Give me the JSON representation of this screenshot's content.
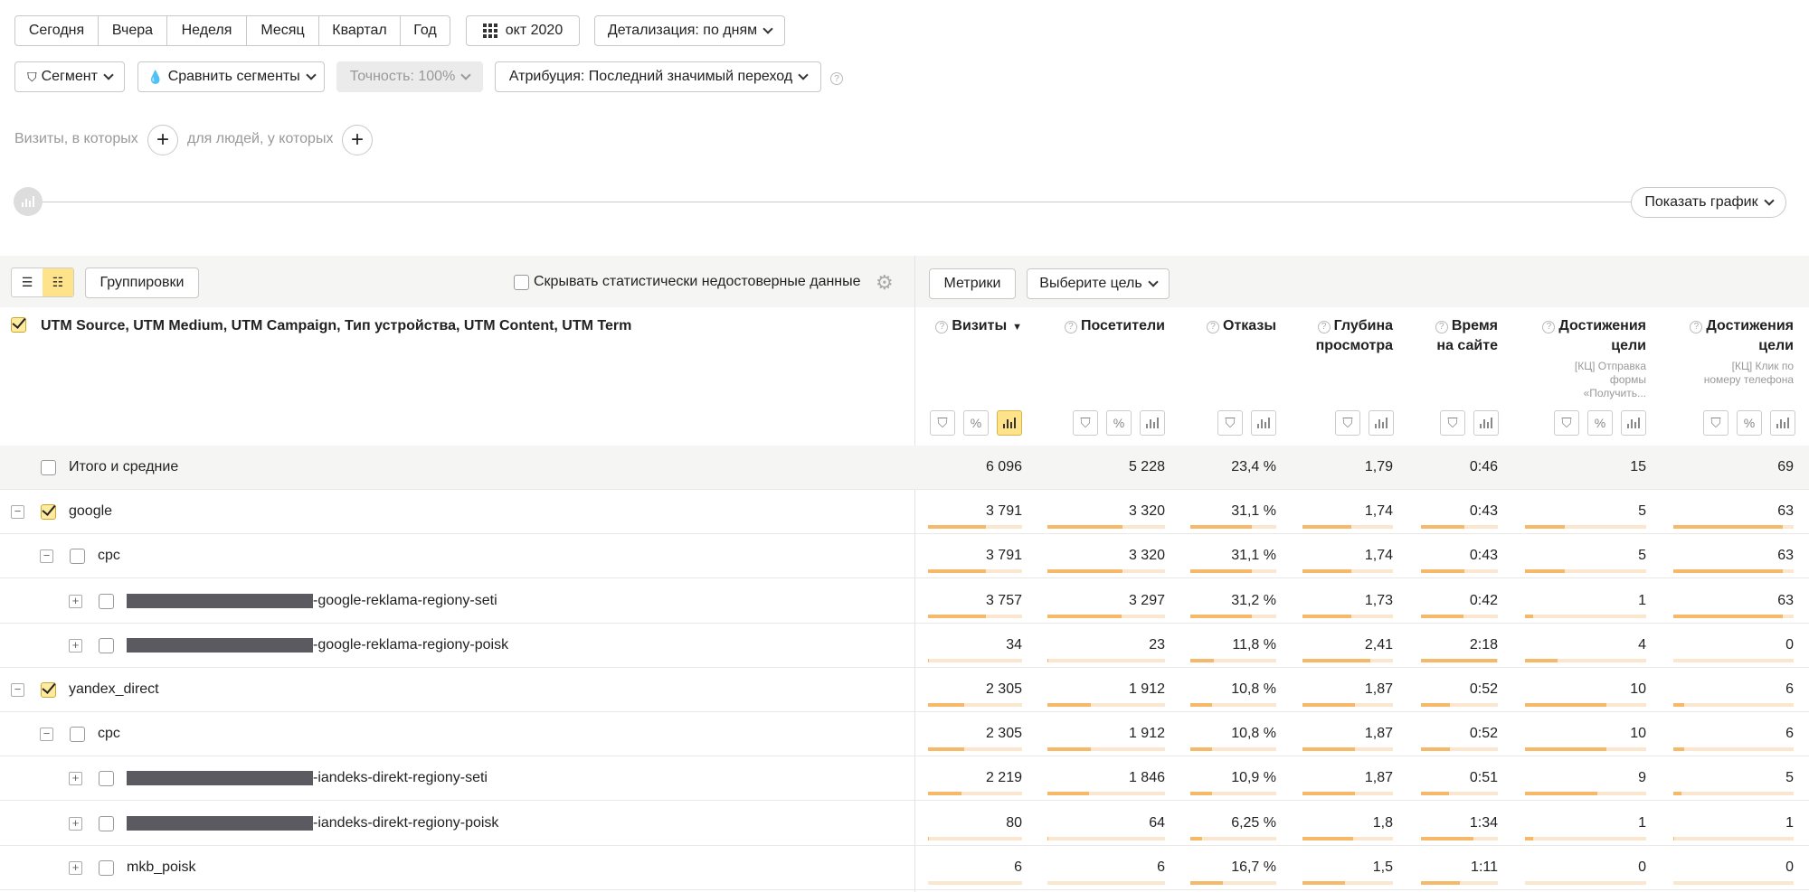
{
  "periods": [
    "Сегодня",
    "Вчера",
    "Неделя",
    "Месяц",
    "Квартал",
    "Год"
  ],
  "date_label": "окт 2020",
  "detail_label": "Детализация: по дням",
  "segment_label": "Сегмент",
  "compare_label": "Сравнить сегменты",
  "accuracy_label": "Точность: 100%",
  "attribution_label": "Атрибуция: Последний значимый переход",
  "visits_where": "Визиты, в которых",
  "people_where": "для людей, у которых",
  "show_chart": "Показать график",
  "groupings_label": "Группировки",
  "hide_unreliable": "Скрывать статистически недостоверные данные",
  "metrics_label": "Метрики",
  "choose_goal": "Выберите цель",
  "dimension_header": "UTM Source, UTM Medium, UTM Campaign, Тип устройства, UTM Content, UTM Term",
  "columns": [
    {
      "line1": "Визиты",
      "line2": "",
      "sub": "",
      "sort": "▼"
    },
    {
      "line1": "Посетители",
      "line2": "",
      "sub": "",
      "sort": ""
    },
    {
      "line1": "Отказы",
      "line2": "",
      "sub": "",
      "sort": ""
    },
    {
      "line1": "Глубина",
      "line2": "просмотра",
      "sub": "",
      "sort": ""
    },
    {
      "line1": "Время",
      "line2": "на сайте",
      "sub": "",
      "sort": ""
    },
    {
      "line1": "Достижения",
      "line2": "цели",
      "sub": "[КЦ] Отправка формы «Получить...",
      "sort": ""
    },
    {
      "line1": "Достижения",
      "line2": "цели",
      "sub": "[КЦ] Клик по номеру телефона",
      "sort": ""
    }
  ],
  "rows": [
    {
      "label": "Итого и средние",
      "values": [
        "6 096",
        "5 228",
        "23,4 %",
        "1,79",
        "0:46",
        "15",
        "69"
      ],
      "fills": [],
      "total": true
    },
    {
      "label": "google",
      "values": [
        "3 791",
        "3 320",
        "31,1 %",
        "1,74",
        "0:43",
        "5",
        "63"
      ],
      "fills": [
        0.62,
        0.64,
        0.72,
        0.54,
        0.56,
        0.33,
        0.91
      ]
    },
    {
      "label": "cpc",
      "values": [
        "3 791",
        "3 320",
        "31,1 %",
        "1,74",
        "0:43",
        "5",
        "63"
      ],
      "fills": [
        0.62,
        0.64,
        0.72,
        0.54,
        0.56,
        0.33,
        0.91
      ]
    },
    {
      "label": "-google-reklama-regiony-seti",
      "values": [
        "3 757",
        "3 297",
        "31,2 %",
        "1,73",
        "0:42",
        "1",
        "63"
      ],
      "fills": [
        0.62,
        0.63,
        0.72,
        0.54,
        0.55,
        0.07,
        0.91
      ]
    },
    {
      "label": "-google-reklama-regiony-poisk",
      "values": [
        "34",
        "23",
        "11,8 %",
        "2,41",
        "2:18",
        "4",
        "0"
      ],
      "fills": [
        0.01,
        0.01,
        0.27,
        0.75,
        0.99,
        0.27,
        0
      ]
    },
    {
      "label": "yandex_direct",
      "values": [
        "2 305",
        "1 912",
        "10,8 %",
        "1,87",
        "0:52",
        "10",
        "6"
      ],
      "fills": [
        0.38,
        0.37,
        0.25,
        0.58,
        0.38,
        0.67,
        0.09
      ]
    },
    {
      "label": "cpc",
      "values": [
        "2 305",
        "1 912",
        "10,8 %",
        "1,87",
        "0:52",
        "10",
        "6"
      ],
      "fills": [
        0.38,
        0.37,
        0.25,
        0.58,
        0.38,
        0.67,
        0.09
      ]
    },
    {
      "label": "-iandeks-direkt-regiony-seti",
      "values": [
        "2 219",
        "1 846",
        "10,9 %",
        "1,87",
        "0:51",
        "9",
        "5"
      ],
      "fills": [
        0.36,
        0.35,
        0.25,
        0.58,
        0.37,
        0.6,
        0.07
      ]
    },
    {
      "label": "-iandeks-direkt-regiony-poisk",
      "values": [
        "80",
        "64",
        "6,25 %",
        "1,8",
        "1:34",
        "1",
        "1"
      ],
      "fills": [
        0.01,
        0.01,
        0.14,
        0.56,
        0.68,
        0.07,
        0.01
      ]
    },
    {
      "label": "mkb_poisk",
      "values": [
        "6",
        "6",
        "16,7 %",
        "1,5",
        "1:11",
        "0",
        "0"
      ],
      "fills": [
        0,
        0,
        0.38,
        0.47,
        0.51,
        0,
        0
      ]
    }
  ],
  "colors": {
    "accent": "#ffe38a",
    "bar": "#f6b96a",
    "bar_track": "#fbe7cf",
    "redaction": "#5a5a60"
  }
}
